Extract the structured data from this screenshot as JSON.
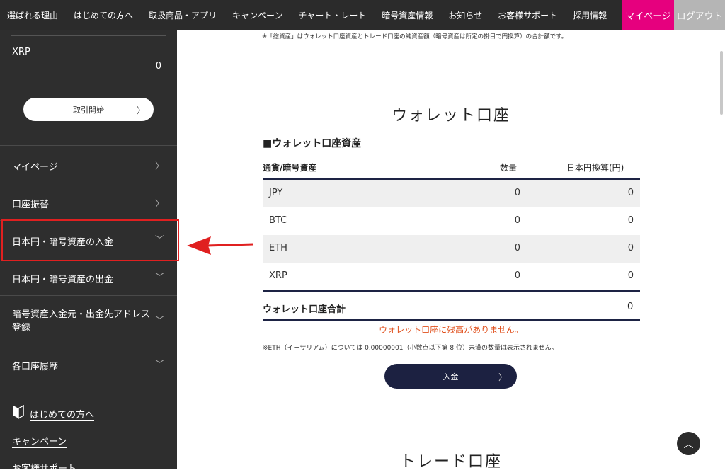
{
  "topnav": {
    "items": [
      "選ばれる理由",
      "はじめての方へ",
      "取扱商品・アプリ",
      "キャンペーン",
      "チャート・レート",
      "暗号資産情報",
      "お知らせ",
      "お客様サポート",
      "採用情報"
    ],
    "mypage": "マイページ",
    "logout": "ログアウト",
    "accent_color": "#e6007e"
  },
  "sidebar": {
    "coin": {
      "name": "XRP",
      "value": "0"
    },
    "trade_button": "取引開始",
    "menu": [
      {
        "label": "マイページ",
        "icon": "chevron-right-icon"
      },
      {
        "label": "口座振替",
        "icon": "chevron-right-icon"
      },
      {
        "label": "日本円・暗号資産の入金",
        "icon": "chevron-down-icon"
      },
      {
        "label": "日本円・暗号資産の出金",
        "icon": "chevron-down-icon"
      },
      {
        "label": "暗号資産入金元・出金先アドレス登録",
        "icon": "chevron-down-icon"
      },
      {
        "label": "各口座履歴",
        "icon": "chevron-down-icon"
      }
    ],
    "links": [
      "はじめての方へ",
      "キャンペーン",
      "お客様サポート"
    ]
  },
  "main": {
    "note_top": "※「総資産」はウォレット口座資産とトレード口座の純資産額（暗号資産は所定の掛目で円換算）の合計額です。",
    "wallet_title": "ウォレット口座",
    "wallet_subtitle": "■ウォレット口座資産",
    "headers": [
      "通貨/暗号資産",
      "数量",
      "日本円換算(円)"
    ],
    "rows": [
      {
        "currency": "JPY",
        "qty": "0",
        "jpy": "0"
      },
      {
        "currency": "BTC",
        "qty": "0",
        "jpy": "0"
      },
      {
        "currency": "ETH",
        "qty": "0",
        "jpy": "0"
      },
      {
        "currency": "XRP",
        "qty": "0",
        "jpy": "0"
      }
    ],
    "total_label": "ウォレット口座合計",
    "total_value": "0",
    "warning": "ウォレット口座に残高がありません。",
    "warning_color": "#e0501d",
    "eth_note": "※ETH（イーサリアム）については 0.00000001（小数点以下第 8 位）未満の数量は表示されません。",
    "deposit_button": "入金",
    "trade_title": "トレード口座"
  }
}
